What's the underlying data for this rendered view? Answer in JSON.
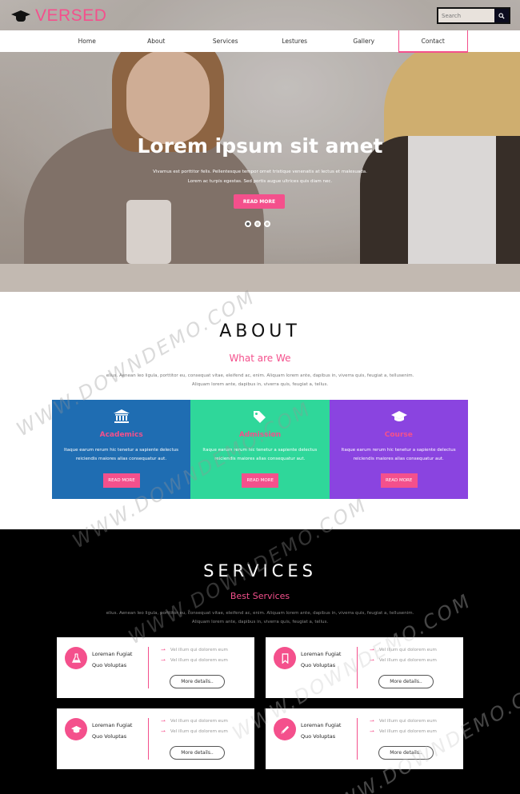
{
  "brand": {
    "logo_text": "VERSED",
    "accent": "#f4508c",
    "dark": "#0b0b1e"
  },
  "search": {
    "placeholder": "Search"
  },
  "nav": {
    "items": [
      "Home",
      "About",
      "Services",
      "Lestures",
      "Gallery",
      "Contact"
    ],
    "active": "Contact"
  },
  "hero": {
    "title": "Lorem ipsum sit amet",
    "subtitle": "Vivamus est porttitor felis. Pellentesque tempor ornet tristique venenatis at lectus et malesuada.\nLorem ac turpis egestas. Sed portis augue ultrices quis diam nec.",
    "button": "READ MORE",
    "slides": 3,
    "active_slide": 1
  },
  "about": {
    "title": "ABOUT",
    "subtitle": "What are We",
    "text": "elius. Aenean leo ligula, porttitor eu, consequat vitae, eleifend ac, enim. Aliquam lorem ante, dapibus in, viverra quis, feugiat a, tellusenim. Aliquam lorem ante, dapibus in, viverra quis, feugiat a, tellus.",
    "cards": [
      {
        "title": "Academics",
        "icon": "institution-icon",
        "color": "#1f6db2",
        "text": "Itaque earum rerum hic tenetur a sapiente delectus reiciendis maiores alias consequatur aut.",
        "button": "READ MORE"
      },
      {
        "title": "Admission",
        "icon": "tags-icon",
        "color": "#2fd79a",
        "text": "Itaque earum rerum hic tenetur a sapiente delectus reiciendis maiores alias consequatur aut.",
        "button": "READ MORE"
      },
      {
        "title": "Course",
        "icon": "graduation-cap-icon",
        "color": "#8a44e0",
        "text": "Itaque earum rerum hic tenetur a sapiente delectus reiciendis maiores alias consequatur aut.",
        "button": "READ MORE"
      }
    ]
  },
  "services": {
    "title": "SERVICES",
    "subtitle": "Best Services",
    "text": "elius. Aenean leo ligula, porttitor eu, consequat vitae, eleifend ac, enim. Aliquam lorem ante, dapibus in, viverra quis, feugiat a, tellusenim. Aliquam lorem ante, dapibus in, viverra quis, feugiat a, tellus.",
    "cards": [
      {
        "icon": "flask-icon",
        "name_line1": "Loreman Fugiat",
        "name_line2": "Quo Voluptas",
        "item1": "Vel illum qui dolorem eum",
        "item2": "Vel illum qui dolorem eum",
        "button": "More details.."
      },
      {
        "icon": "bookmark-icon",
        "name_line1": "Loreman Fugiat",
        "name_line2": "Quo Voluptas",
        "item1": "Vel illum qui dolorem eum",
        "item2": "Vel illum qui dolorem eum",
        "button": "More details.."
      },
      {
        "icon": "graduation-cap-icon",
        "name_line1": "Loreman Fugiat",
        "name_line2": "Quo Voluptas",
        "item1": "Vel illum qui dolorem eum",
        "item2": "Vel illum qui dolorem eum",
        "button": "More details.."
      },
      {
        "icon": "pencil-icon",
        "name_line1": "Loreman Fugiat",
        "name_line2": "Quo Voluptas",
        "item1": "Vel illum qui dolorem eum",
        "item2": "Vel illum qui dolorem eum",
        "button": "More details.."
      }
    ]
  },
  "watermark": "WWW.DOWNDEMO.COM"
}
